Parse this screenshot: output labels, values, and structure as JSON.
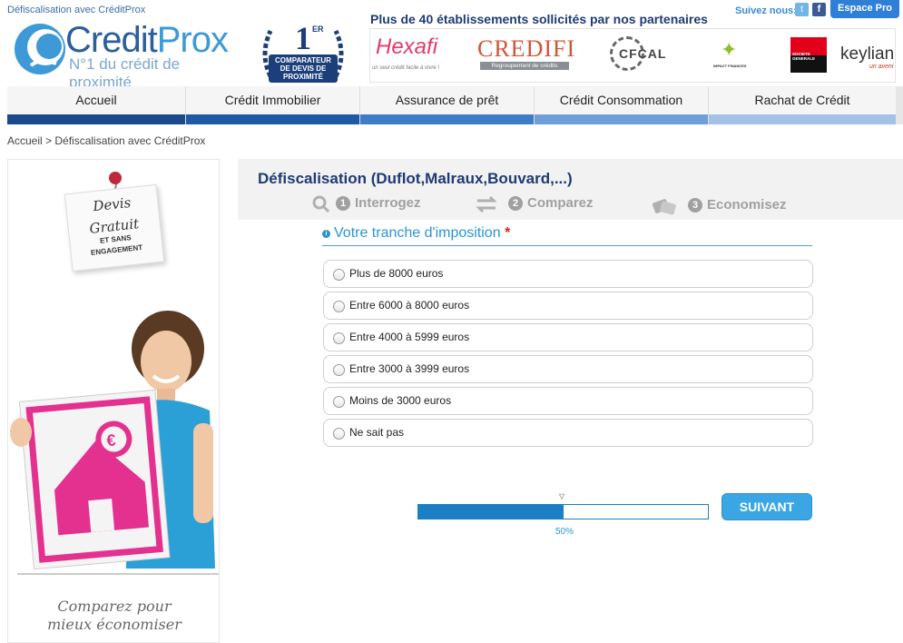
{
  "header": {
    "top_link": "Défiscalisation avec CréditProx",
    "logo_part1": "Credit",
    "logo_part2": "Prox",
    "logo_tagline": "N°1 du crédit de proximité",
    "badge_rank": "1",
    "badge_rank_suffix": "ER",
    "badge_line1": "COMPARATEUR",
    "badge_line2": "DE DEVIS DE",
    "badge_line3": "PROXIMITÉ",
    "partners_title": "Plus de 40 établissements sollicités par nos partenaires",
    "follow_label": "Suivez nous:",
    "espace_pro_label": "Espace Pro",
    "partners": {
      "hexafi": "Hexafi",
      "hexafi_sub": "un seul crédit facile à vivre !",
      "credifi": "CREDIFI",
      "credifi_sub": "Regroupement de crédits",
      "cfcal": "CFCAL",
      "impact": "IMPACT FINANCES",
      "sg": "SOCIETE GENERALE",
      "keylian": "keylian",
      "keylian_sub": "un aveni"
    }
  },
  "nav": {
    "items": [
      {
        "label": "Accueil",
        "bar_color": "#1a4a8c"
      },
      {
        "label": "Crédit Immobilier",
        "bar_color": "#1f5aa6"
      },
      {
        "label": "Assurance de prêt",
        "bar_color": "#3f7cc7"
      },
      {
        "label": "Crédit Consommation",
        "bar_color": "#6f9fd8"
      },
      {
        "label": "Rachat de Crédit",
        "bar_color": "#a4c2e8"
      }
    ]
  },
  "breadcrumb": "Accueil > Défiscalisation avec CréditProx",
  "banner": {
    "note_line1": "Devis",
    "note_line2": "Gratuit",
    "note_line3": "ET SANS",
    "note_line4": "ENGAGEMENT",
    "caption_line1": "Comparez pour",
    "caption_line2": "mieux économiser"
  },
  "form": {
    "title": "Défiscalisation (Duflot,Malraux,Bouvard,...)",
    "steps": [
      {
        "num": "1",
        "label": "Interrogez"
      },
      {
        "num": "2",
        "label": "Comparez"
      },
      {
        "num": "3",
        "label": "Economisez"
      }
    ],
    "question": "Votre tranche d'imposition",
    "required_mark": "*",
    "options": [
      "Plus de 8000 euros",
      "Entre 6000 à 8000 euros",
      "Entre 4000 à 5999 euros",
      "Entre 3000 à 3999 euros",
      "Moins de 3000 euros",
      "Ne sait pas"
    ],
    "progress_fraction": 0.5,
    "progress_text": "50%",
    "next_label": "SUIVANT"
  },
  "colors": {
    "brand_dark": "#1f3b73",
    "accent": "#2a95d3",
    "button": "#3aa6e3"
  }
}
